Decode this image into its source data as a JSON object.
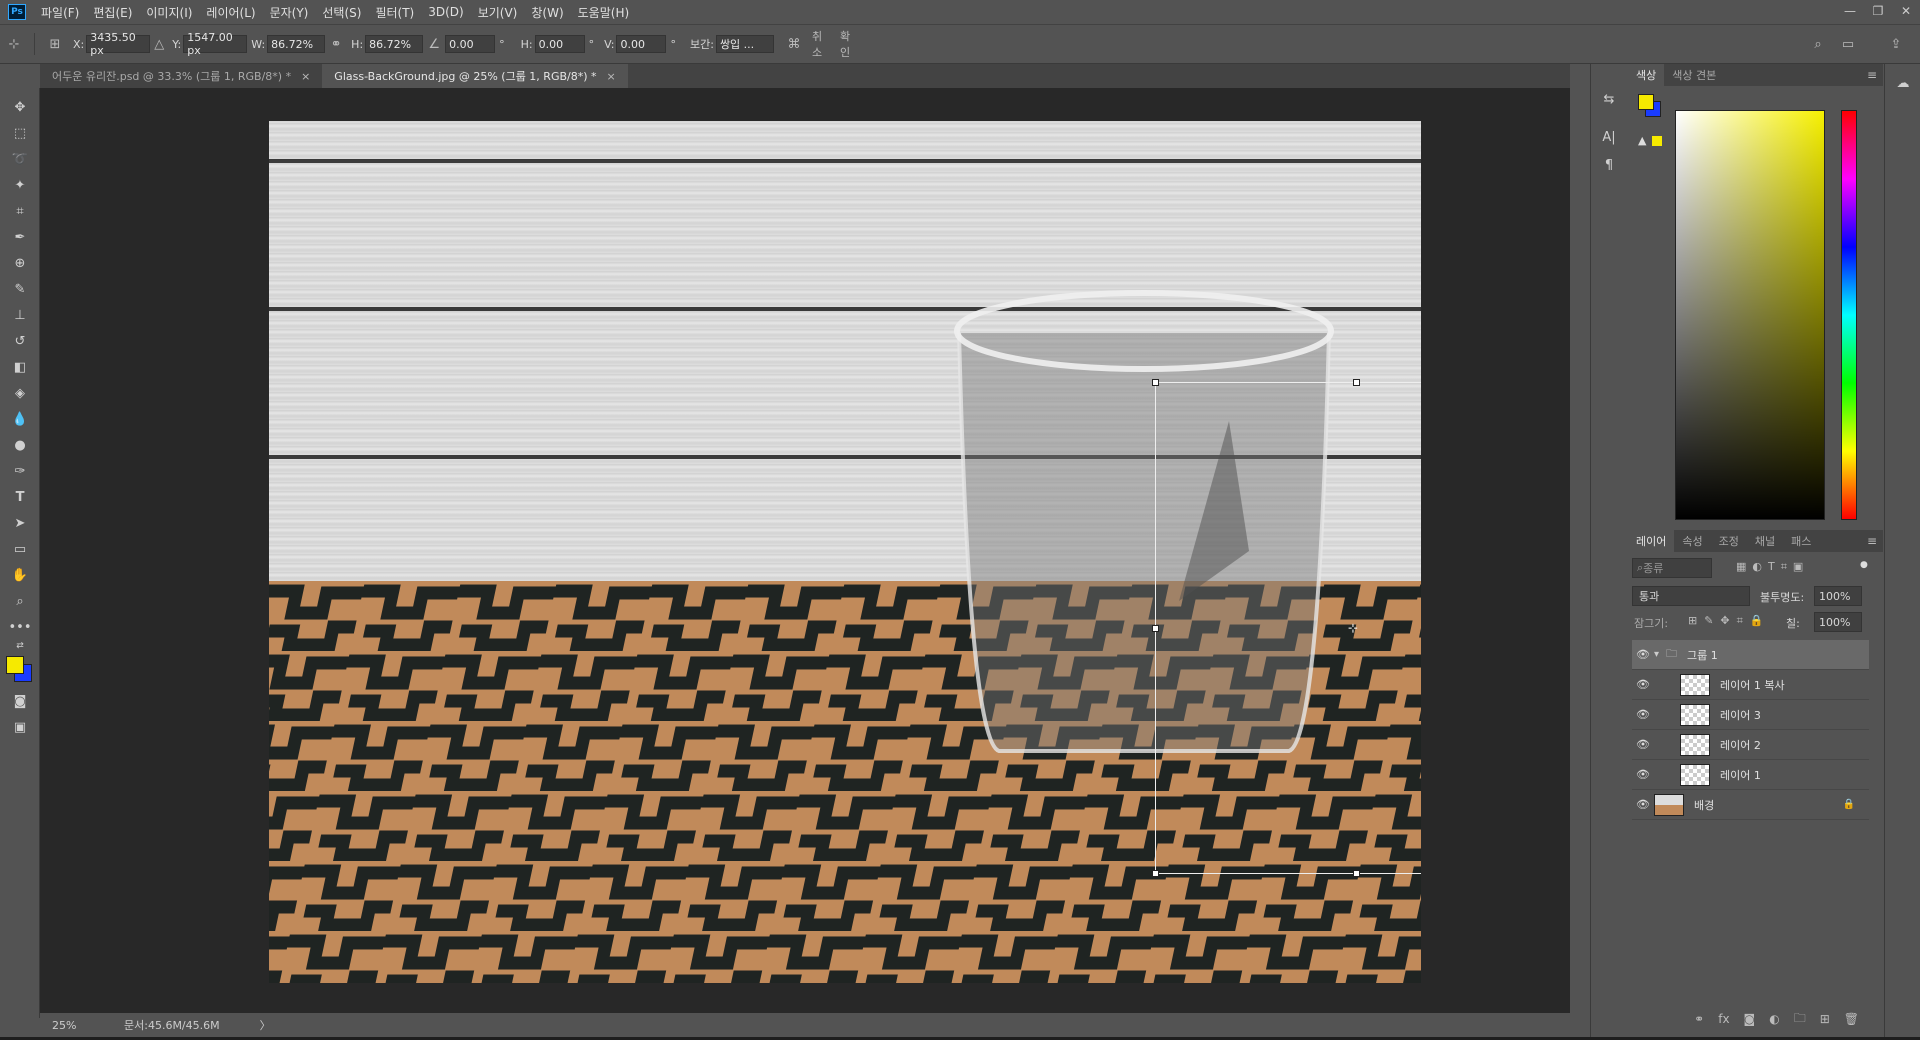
{
  "menu": {
    "logo": "Ps",
    "items": [
      "파일(F)",
      "편집(E)",
      "이미지(I)",
      "레이어(L)",
      "문자(Y)",
      "선택(S)",
      "필터(T)",
      "3D(D)",
      "보기(V)",
      "창(W)",
      "도움말(H)"
    ]
  },
  "options": {
    "x_label": "X:",
    "x_value": "3435.50 px",
    "y_label": "Y:",
    "y_value": "1547.00 px",
    "w_label": "W:",
    "w_value": "86.72%",
    "h_label": "H:",
    "h_value": "86.72%",
    "angle_value": "0.00",
    "hskew_label": "H:",
    "hskew_value": "0.00",
    "vskew_label": "V:",
    "vskew_value": "0.00",
    "degree": "°",
    "interp_label": "보간:",
    "interp_value": "쌍입 ...",
    "cancel": "취소",
    "confirm": "확인"
  },
  "tabs": [
    {
      "label": "어두운 유리잔.psd @ 33.3% (그룹 1, RGB/8*) *",
      "close": "×"
    },
    {
      "label": "Glass-BackGround.jpg @ 25% (그룹 1, RGB/8*) *",
      "close": "×"
    }
  ],
  "status": {
    "zoom": "25%",
    "doc": "문서:45.6M/45.6M",
    "arrow": "〉"
  },
  "color_panel": {
    "tabs": [
      "색상",
      "색상 견본"
    ],
    "foreground": "#f6ea00",
    "background": "#1a3cff"
  },
  "layers_panel": {
    "tabs": [
      "레이어",
      "속성",
      "조정",
      "채널",
      "패스"
    ],
    "filter_placeholder": "종류",
    "blend_mode": "통과",
    "opacity_label": "불투명도:",
    "opacity_value": "100%",
    "lock_label": "잠그기:",
    "fill_label": "칠:",
    "fill_value": "100%",
    "group_name": "그룹 1",
    "layers": [
      {
        "name": "레이어 1 복사"
      },
      {
        "name": "레이어 3"
      },
      {
        "name": "레이어 2"
      },
      {
        "name": "레이어 1"
      }
    ],
    "background_name": "배경"
  }
}
